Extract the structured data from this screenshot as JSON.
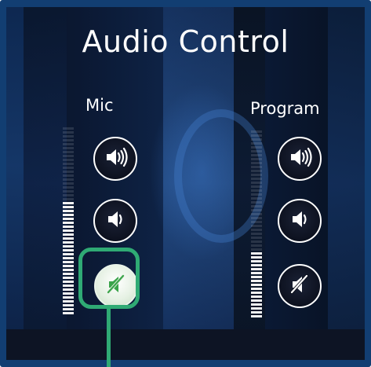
{
  "title": "Audio Control",
  "mic": {
    "label": "Mic",
    "level": 0.6,
    "buttons": {
      "volume_up": "volume-up-icon",
      "volume_down": "volume-down-icon",
      "mute": "mute-icon"
    },
    "muted": true
  },
  "program": {
    "label": "Program",
    "level": 0.36,
    "buttons": {
      "volume_up": "volume-up-icon",
      "volume_down": "volume-down-icon",
      "mute": "mute-icon"
    },
    "muted": false
  },
  "colors": {
    "frame": "#123e72",
    "highlight": "#2faa74",
    "mute_active_icon": "#3aa44a",
    "meter_on": "#f2f2f2"
  }
}
